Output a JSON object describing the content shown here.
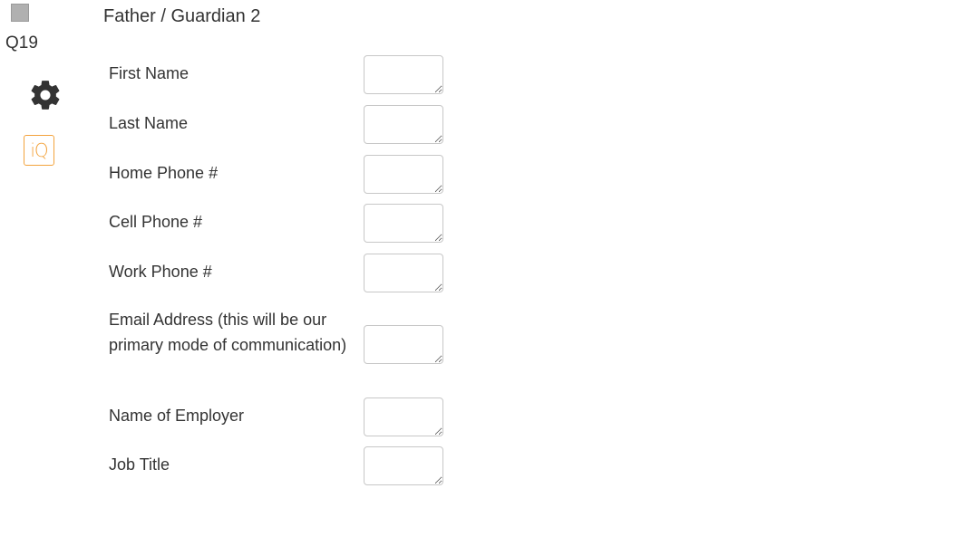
{
  "question": {
    "id": "Q19",
    "title": "Father / Guardian 2"
  },
  "rail": {
    "settings_icon": "gear-icon",
    "iq_badge": "iQ",
    "accent_color": "#f3a33d"
  },
  "fields": [
    {
      "label": "First Name",
      "value": ""
    },
    {
      "label": "Last Name",
      "value": ""
    },
    {
      "label": "Home Phone #",
      "value": ""
    },
    {
      "label": "Cell Phone #",
      "value": ""
    },
    {
      "label": "Work Phone #",
      "value": ""
    },
    {
      "label": "Email Address (this will be our primary mode of communication)",
      "value": ""
    },
    {
      "label": "Name of Employer",
      "value": ""
    },
    {
      "label": "Job Title",
      "value": ""
    }
  ]
}
